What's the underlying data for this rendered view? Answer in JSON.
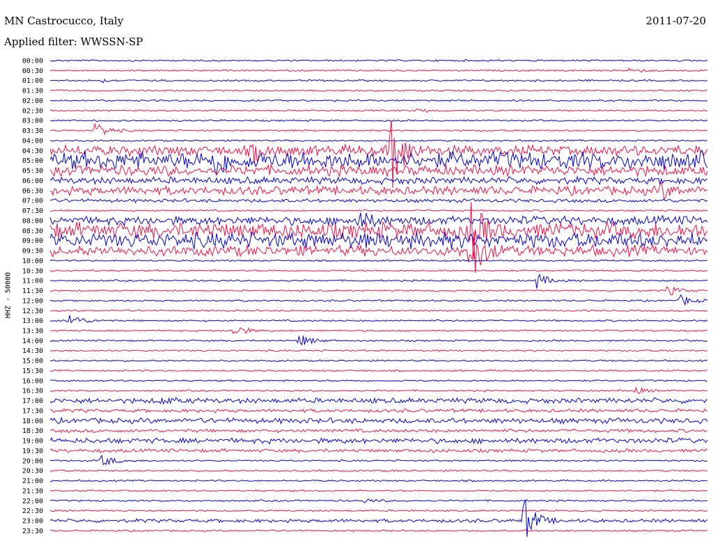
{
  "header": {
    "station": "MN Castrocucco, Italy",
    "date": "2011-07-20",
    "filter": "Applied filter: WWSSN-SP"
  },
  "chart_data": {
    "type": "line",
    "title": "MN Castrocucco, Italy",
    "ylabel": "HHZ - 50000",
    "row_labels": [
      "00:00",
      "00:30",
      "01:00",
      "01:30",
      "02:00",
      "02:30",
      "03:00",
      "03:30",
      "04:00",
      "04:30",
      "05:00",
      "05:30",
      "06:00",
      "06:30",
      "07:00",
      "07:30",
      "08:00",
      "08:30",
      "09:00",
      "09:30",
      "10:00",
      "10:30",
      "11:00",
      "11:30",
      "12:00",
      "12:30",
      "13:00",
      "13:30",
      "14:00",
      "14:30",
      "15:00",
      "15:30",
      "16:00",
      "16:30",
      "17:00",
      "17:30",
      "18:00",
      "18:30",
      "19:00",
      "19:30",
      "20:00",
      "20:30",
      "21:00",
      "21:30",
      "22:00",
      "22:30",
      "23:00",
      "23:30"
    ],
    "colors": [
      "#0000cc",
      "#ee1144"
    ],
    "events": [
      {
        "row": 1,
        "at": 0.88,
        "amp": 5
      },
      {
        "row": 2,
        "at": 0.08,
        "amp": 2
      },
      {
        "row": 5,
        "at": 0.56,
        "amp": 3
      },
      {
        "row": 7,
        "at": 0.07,
        "amp": 14
      },
      {
        "row": 9,
        "at": 0.52,
        "amp": 60
      },
      {
        "row": 9,
        "at": 0.31,
        "amp": 12
      },
      {
        "row": 10,
        "at": 0.25,
        "amp": 20
      },
      {
        "row": 13,
        "at": 0.93,
        "amp": 10
      },
      {
        "row": 16,
        "at": 0.47,
        "amp": 14
      },
      {
        "row": 17,
        "at": 0.64,
        "amp": 40
      },
      {
        "row": 19,
        "at": 0.64,
        "amp": 50
      },
      {
        "row": 22,
        "at": 0.74,
        "amp": 12
      },
      {
        "row": 23,
        "at": 0.94,
        "amp": 8
      },
      {
        "row": 24,
        "at": 0.96,
        "amp": 8
      },
      {
        "row": 26,
        "at": 0.03,
        "amp": 12
      },
      {
        "row": 27,
        "at": 0.28,
        "amp": 10
      },
      {
        "row": 28,
        "at": 0.38,
        "amp": 10
      },
      {
        "row": 33,
        "at": 0.89,
        "amp": 5
      },
      {
        "row": 34,
        "at": 0.17,
        "amp": 4
      },
      {
        "row": 40,
        "at": 0.08,
        "amp": 10
      },
      {
        "row": 44,
        "at": 0.48,
        "amp": 3
      },
      {
        "row": 46,
        "at": 0.72,
        "amp": 36
      }
    ],
    "noise_levels": [
      1,
      1,
      1,
      1,
      1,
      1,
      1,
      1,
      1,
      6,
      10,
      6,
      4,
      5,
      2,
      1,
      5,
      9,
      9,
      6,
      1,
      1,
      1,
      1,
      1,
      1,
      1,
      1,
      1,
      1,
      1,
      1,
      1,
      1,
      3,
      2,
      3,
      2,
      3,
      2,
      1,
      1,
      1,
      1,
      1,
      1,
      2,
      1
    ]
  }
}
